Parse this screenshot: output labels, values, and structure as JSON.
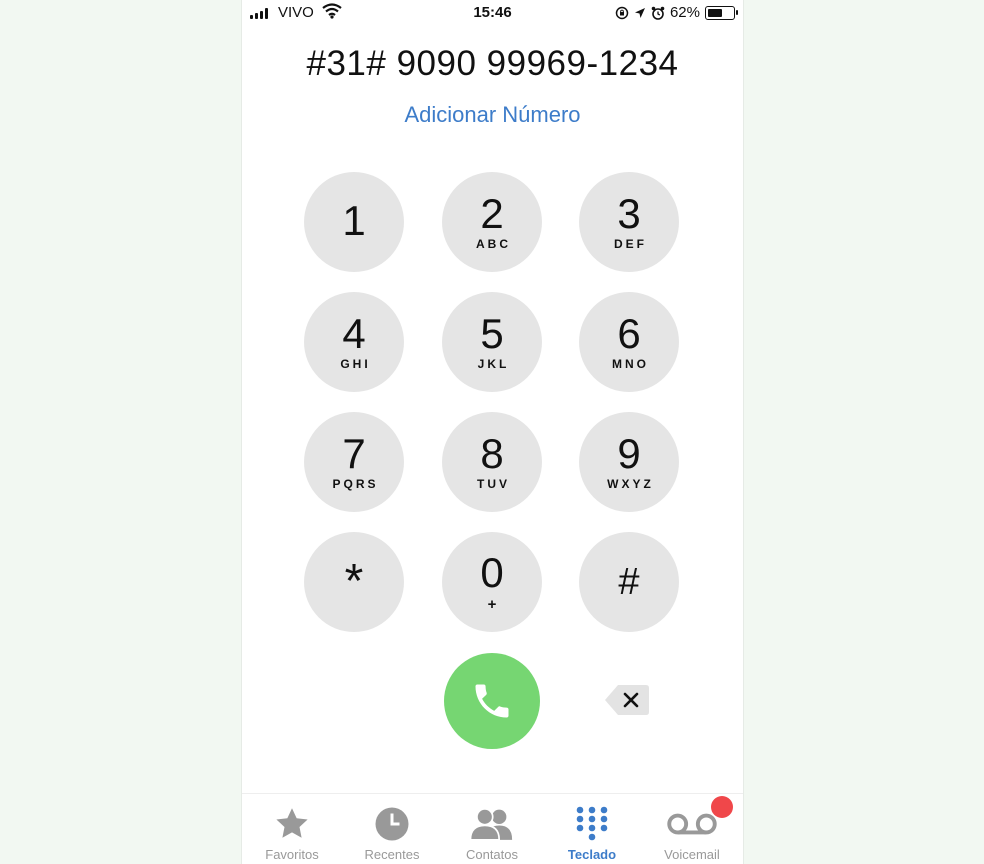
{
  "status_bar": {
    "carrier": "VIVO",
    "time": "15:46",
    "battery_percent": "62%",
    "battery_level": 0.62
  },
  "dial": {
    "number": "#31# 9090 99969-1234",
    "add_number_label": "Adicionar Número"
  },
  "keypad": [
    {
      "digit": "1",
      "letters": ""
    },
    {
      "digit": "2",
      "letters": "ABC"
    },
    {
      "digit": "3",
      "letters": "DEF"
    },
    {
      "digit": "4",
      "letters": "GHI"
    },
    {
      "digit": "5",
      "letters": "JKL"
    },
    {
      "digit": "6",
      "letters": "MNO"
    },
    {
      "digit": "7",
      "letters": "PQRS"
    },
    {
      "digit": "8",
      "letters": "TUV"
    },
    {
      "digit": "9",
      "letters": "WXYZ"
    },
    {
      "digit": "*",
      "letters": ""
    },
    {
      "digit": "0",
      "letters": "+"
    },
    {
      "digit": "#",
      "letters": ""
    }
  ],
  "tabs": [
    {
      "label": "Favoritos",
      "icon": "star-icon"
    },
    {
      "label": "Recentes",
      "icon": "clock-icon"
    },
    {
      "label": "Contatos",
      "icon": "contacts-icon"
    },
    {
      "label": "Teclado",
      "icon": "keypad-icon",
      "active": true
    },
    {
      "label": "Voicemail",
      "icon": "voicemail-icon"
    }
  ],
  "colors": {
    "accent": "#3d7cc9",
    "call_green": "#76d672",
    "key_bg": "#e5e5e5",
    "badge_red": "#f0474a"
  }
}
